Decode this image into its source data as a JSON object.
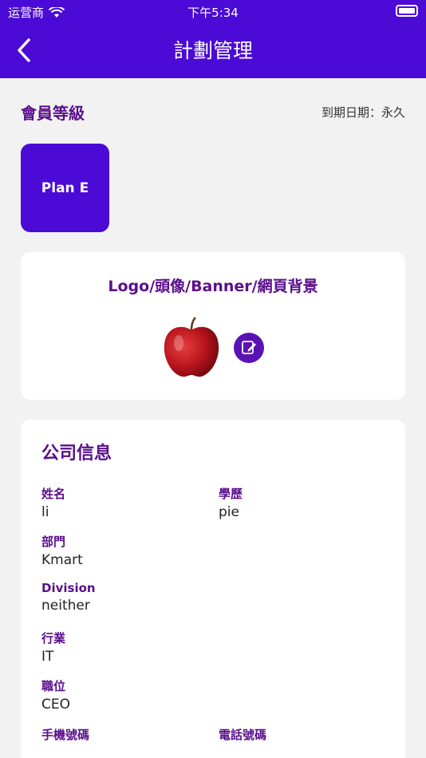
{
  "status_bar": {
    "carrier": "运营商",
    "time": "下午5:34"
  },
  "nav": {
    "title": "計劃管理"
  },
  "membership": {
    "title": "會員等級",
    "expiry": "到期日期：永久",
    "plan": "Plan E"
  },
  "media": {
    "title": "Logo/頭像/Banner/網頁背景"
  },
  "company": {
    "title": "公司信息",
    "fields": [
      {
        "label": "姓名",
        "value": "li"
      },
      {
        "label": "學歷",
        "value": "pie"
      },
      {
        "label": "部門",
        "value": "Kmart"
      },
      {
        "label": "Division",
        "value": "neither"
      },
      {
        "label": "行業",
        "value": "IT"
      },
      {
        "label": "職位",
        "value": "CEO"
      },
      {
        "label": "手機號碼",
        "value": ""
      },
      {
        "label": "電話號碼",
        "value": ""
      }
    ]
  },
  "colors": {
    "brand": "#4b0ad6",
    "accent_text": "#5a0f8c",
    "background": "#f2f2f3"
  }
}
